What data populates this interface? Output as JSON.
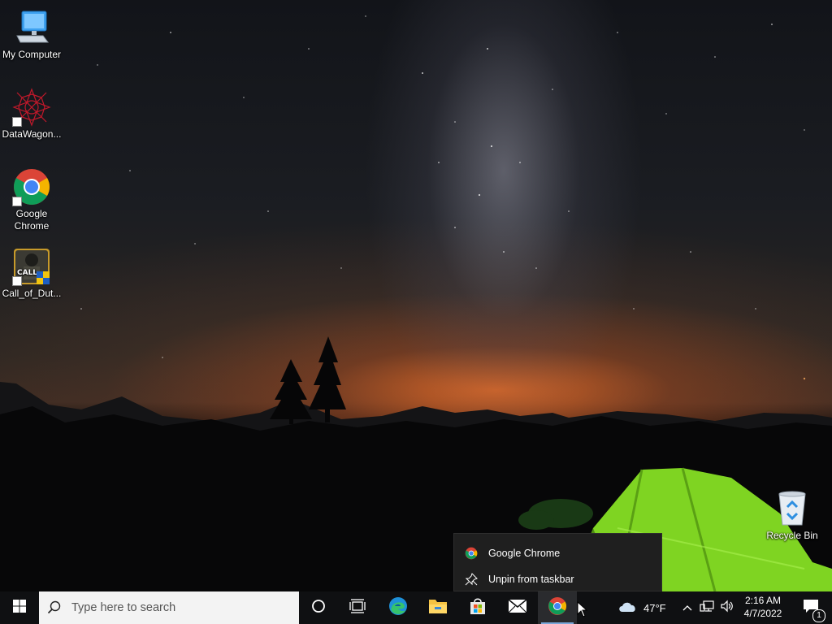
{
  "desktop": {
    "icons": [
      {
        "label": "My Computer",
        "icon": "computer-icon"
      },
      {
        "label": "DataWagon...",
        "icon": "datawagon-icon"
      },
      {
        "label": "Google Chrome",
        "icon": "chrome-icon"
      },
      {
        "label": "Call_of_Dut...",
        "icon": "call-of-duty-icon"
      },
      {
        "label": "Recycle Bin",
        "icon": "recycle-bin-icon"
      }
    ]
  },
  "jumplist": {
    "items": [
      {
        "label": "Google Chrome",
        "icon": "chrome-icon"
      },
      {
        "label": "Unpin from taskbar",
        "icon": "unpin-icon"
      }
    ]
  },
  "taskbar": {
    "search_placeholder": "Type here to search",
    "pinned": [
      "start-icon",
      "cortana-icon",
      "task-view-icon",
      "edge-icon",
      "file-explorer-icon",
      "store-icon",
      "mail-icon",
      "chrome-icon"
    ],
    "weather": {
      "temp": "47°F",
      "icon": "cloud-icon"
    },
    "clock": {
      "time": "2:16 AM",
      "date": "4/7/2022"
    },
    "notifications_count": "1"
  },
  "colors": {
    "taskbar_bg": "#0f1012",
    "jumplist_bg": "#1f1f1f",
    "accent": "#7aa7d8",
    "tent_green": "#8be02a"
  }
}
